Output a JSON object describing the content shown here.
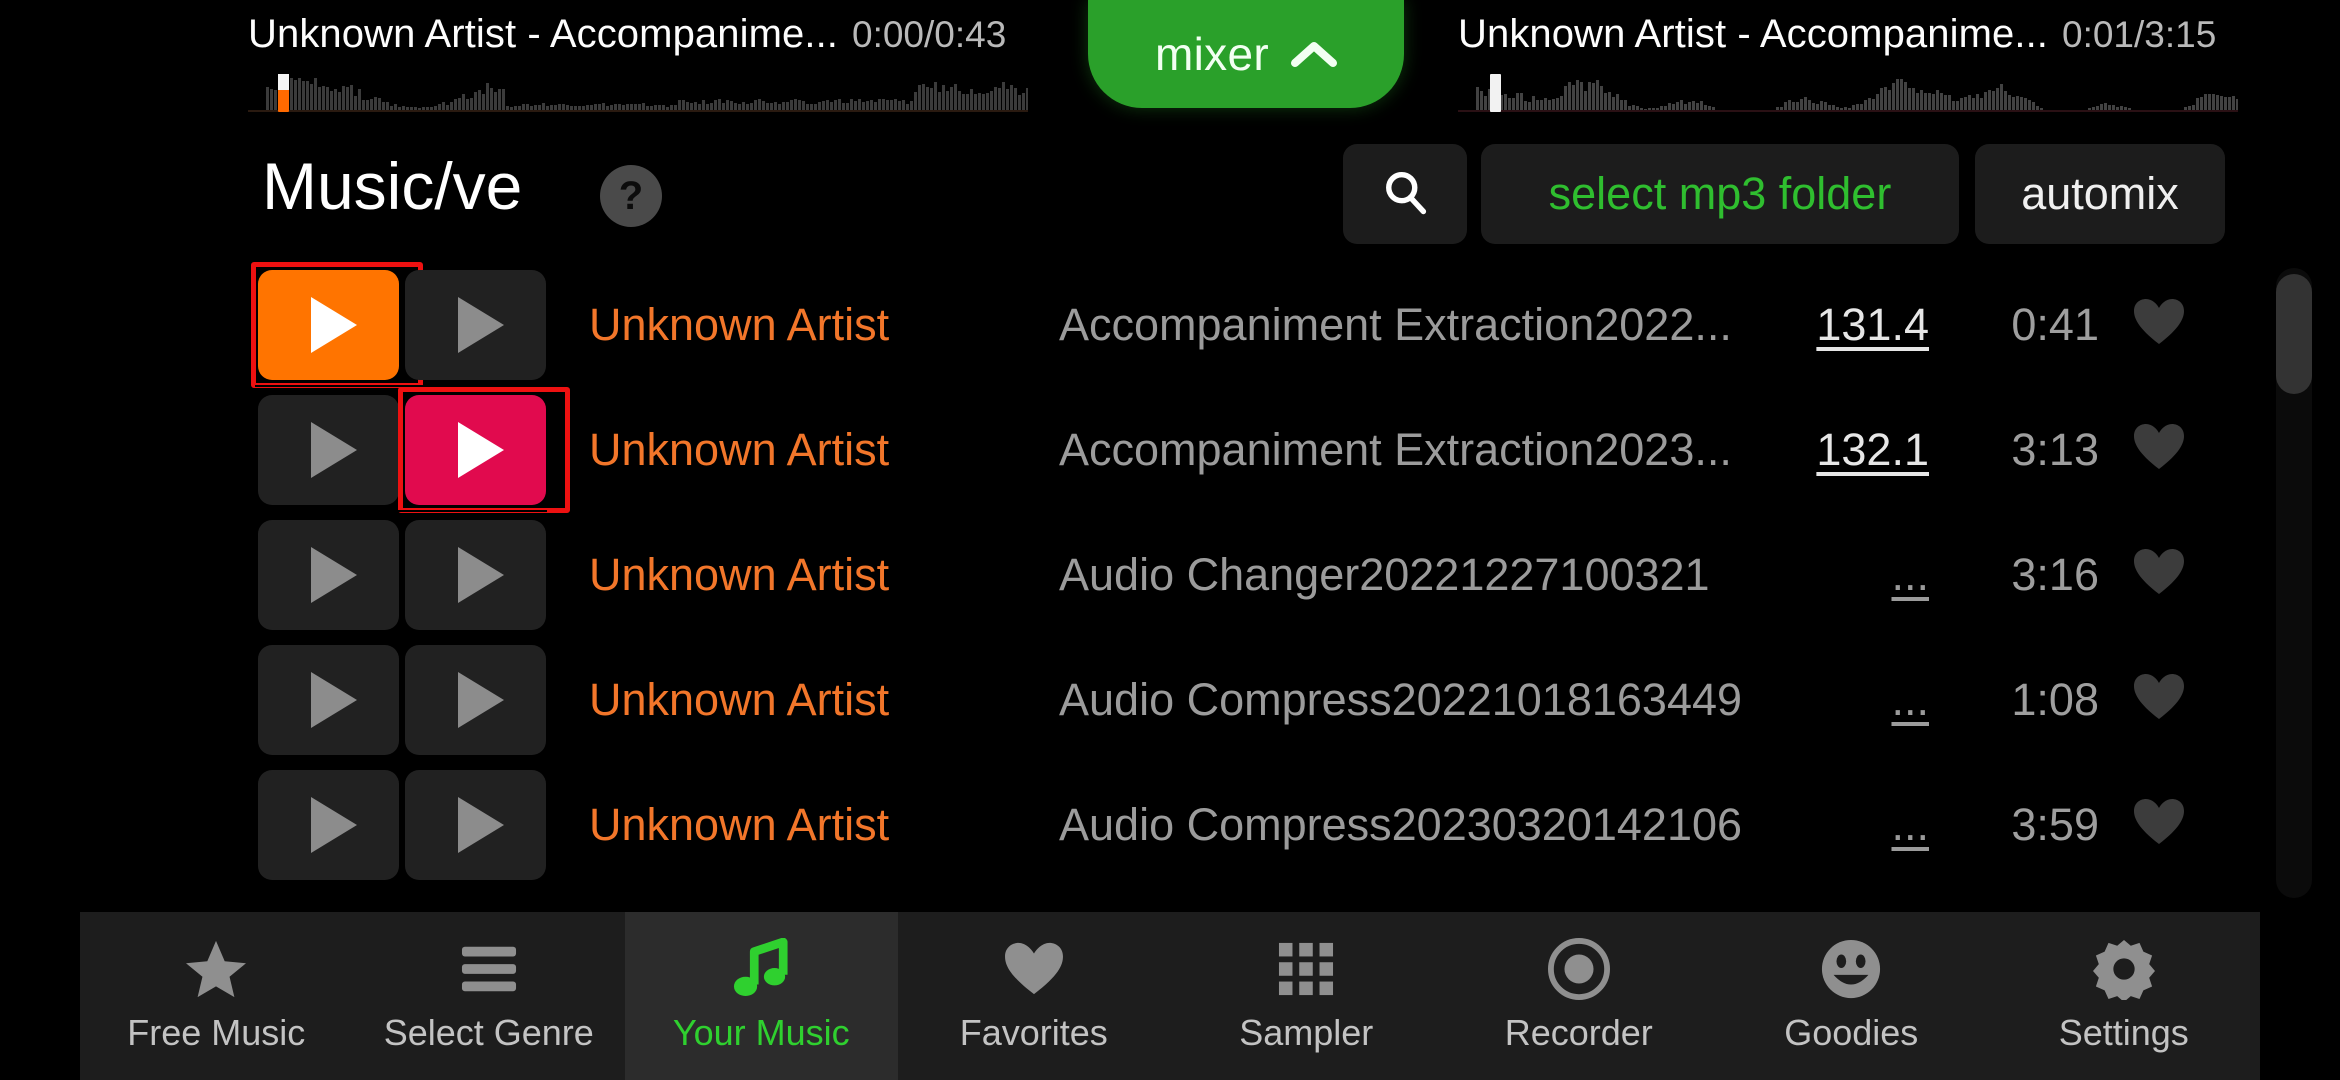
{
  "colors": {
    "accent_green": "#2aa02a",
    "active_green": "#2fd02f",
    "deck_a_orange": "#ff7400",
    "deck_b_pink": "#e10a4e",
    "artist_orange": "#f2762a",
    "select_ring_red": "#ee1111",
    "background": "#000000",
    "panel": "#1d1d1d"
  },
  "decks": {
    "left": {
      "track": "Unknown Artist - Accompanime...",
      "time": "0:00/0:43",
      "position_seconds": 0,
      "duration": "0:43"
    },
    "right": {
      "track": "Unknown Artist - Accompanime...",
      "time": "0:01/3:15",
      "position_seconds": 1,
      "duration": "3:15"
    }
  },
  "mixer_button": {
    "label": "mixer",
    "icon": "chevron-up-icon",
    "expanded": false
  },
  "header": {
    "title": "Music/ve",
    "help_label": "?",
    "search_icon": "search-icon",
    "select_folder_label": "select mp3 folder",
    "automix_label": "automix"
  },
  "tracks": [
    {
      "deck_a_loaded": true,
      "deck_b_loaded": false,
      "artist": "Unknown Artist",
      "title": "Accompaniment Extraction2022...",
      "bpm": "131.4",
      "duration": "0:41",
      "favorite": false
    },
    {
      "deck_a_loaded": false,
      "deck_b_loaded": true,
      "artist": "Unknown Artist",
      "title": "Accompaniment Extraction2023...",
      "bpm": "132.1",
      "duration": "3:13",
      "favorite": false
    },
    {
      "deck_a_loaded": false,
      "deck_b_loaded": false,
      "artist": "Unknown Artist",
      "title": "Audio Changer20221227100321",
      "bpm": "...",
      "duration": "3:16",
      "favorite": false
    },
    {
      "deck_a_loaded": false,
      "deck_b_loaded": false,
      "artist": "Unknown Artist",
      "title": "Audio Compress20221018163449",
      "bpm": "...",
      "duration": "1:08",
      "favorite": false
    },
    {
      "deck_a_loaded": false,
      "deck_b_loaded": false,
      "artist": "Unknown Artist",
      "title": "Audio Compress20230320142106",
      "bpm": "...",
      "duration": "3:59",
      "favorite": false
    }
  ],
  "nav": {
    "active_index": 2,
    "items": [
      {
        "label": "Free Music",
        "icon": "star-icon"
      },
      {
        "label": "Select Genre",
        "icon": "list-icon"
      },
      {
        "label": "Your Music",
        "icon": "music-note-icon"
      },
      {
        "label": "Favorites",
        "icon": "heart-icon"
      },
      {
        "label": "Sampler",
        "icon": "grid-icon"
      },
      {
        "label": "Recorder",
        "icon": "record-icon"
      },
      {
        "label": "Goodies",
        "icon": "smiley-icon"
      },
      {
        "label": "Settings",
        "icon": "gear-icon"
      }
    ]
  }
}
